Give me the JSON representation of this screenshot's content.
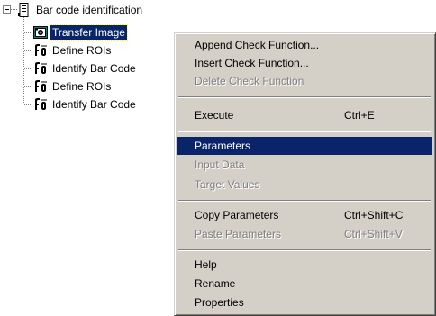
{
  "tree": {
    "root": {
      "label": "Bar code identification",
      "expander_state": "expanded",
      "icon": "document-icon"
    },
    "children": [
      {
        "label": "Transfer Image",
        "icon": "camera-icon",
        "selected": true
      },
      {
        "label": "Define ROIs",
        "icon": "check-function-icon",
        "selected": false
      },
      {
        "label": "Identify Bar Code",
        "icon": "check-function-icon",
        "selected": false
      },
      {
        "label": "Define ROIs",
        "icon": "check-function-icon",
        "selected": false
      },
      {
        "label": "Identify Bar Code",
        "icon": "check-function-icon",
        "selected": false
      }
    ]
  },
  "context_menu": {
    "items": [
      {
        "label": "Append Check Function...",
        "shortcut": "",
        "disabled": false
      },
      {
        "label": "Insert Check Function...",
        "shortcut": "",
        "disabled": false
      },
      {
        "label": "Delete Check Function",
        "shortcut": "",
        "disabled": true
      },
      {
        "label": "Execute",
        "shortcut": "Ctrl+E",
        "disabled": false
      },
      {
        "label": "Parameters",
        "shortcut": "",
        "disabled": false,
        "highlighted": true
      },
      {
        "label": "Input Data",
        "shortcut": "",
        "disabled": true
      },
      {
        "label": "Target Values",
        "shortcut": "",
        "disabled": true
      },
      {
        "label": "Copy Parameters",
        "shortcut": "Ctrl+Shift+C",
        "disabled": false
      },
      {
        "label": "Paste Parameters",
        "shortcut": "Ctrl+Shift+V",
        "disabled": true
      },
      {
        "label": "Help",
        "shortcut": "",
        "disabled": false
      },
      {
        "label": "Rename",
        "shortcut": "",
        "disabled": false
      },
      {
        "label": "Properties",
        "shortcut": "",
        "disabled": false
      }
    ]
  },
  "colors": {
    "menu_background": "#d4d0c8",
    "highlight": "#0a246a",
    "disabled_text": "#808080"
  }
}
